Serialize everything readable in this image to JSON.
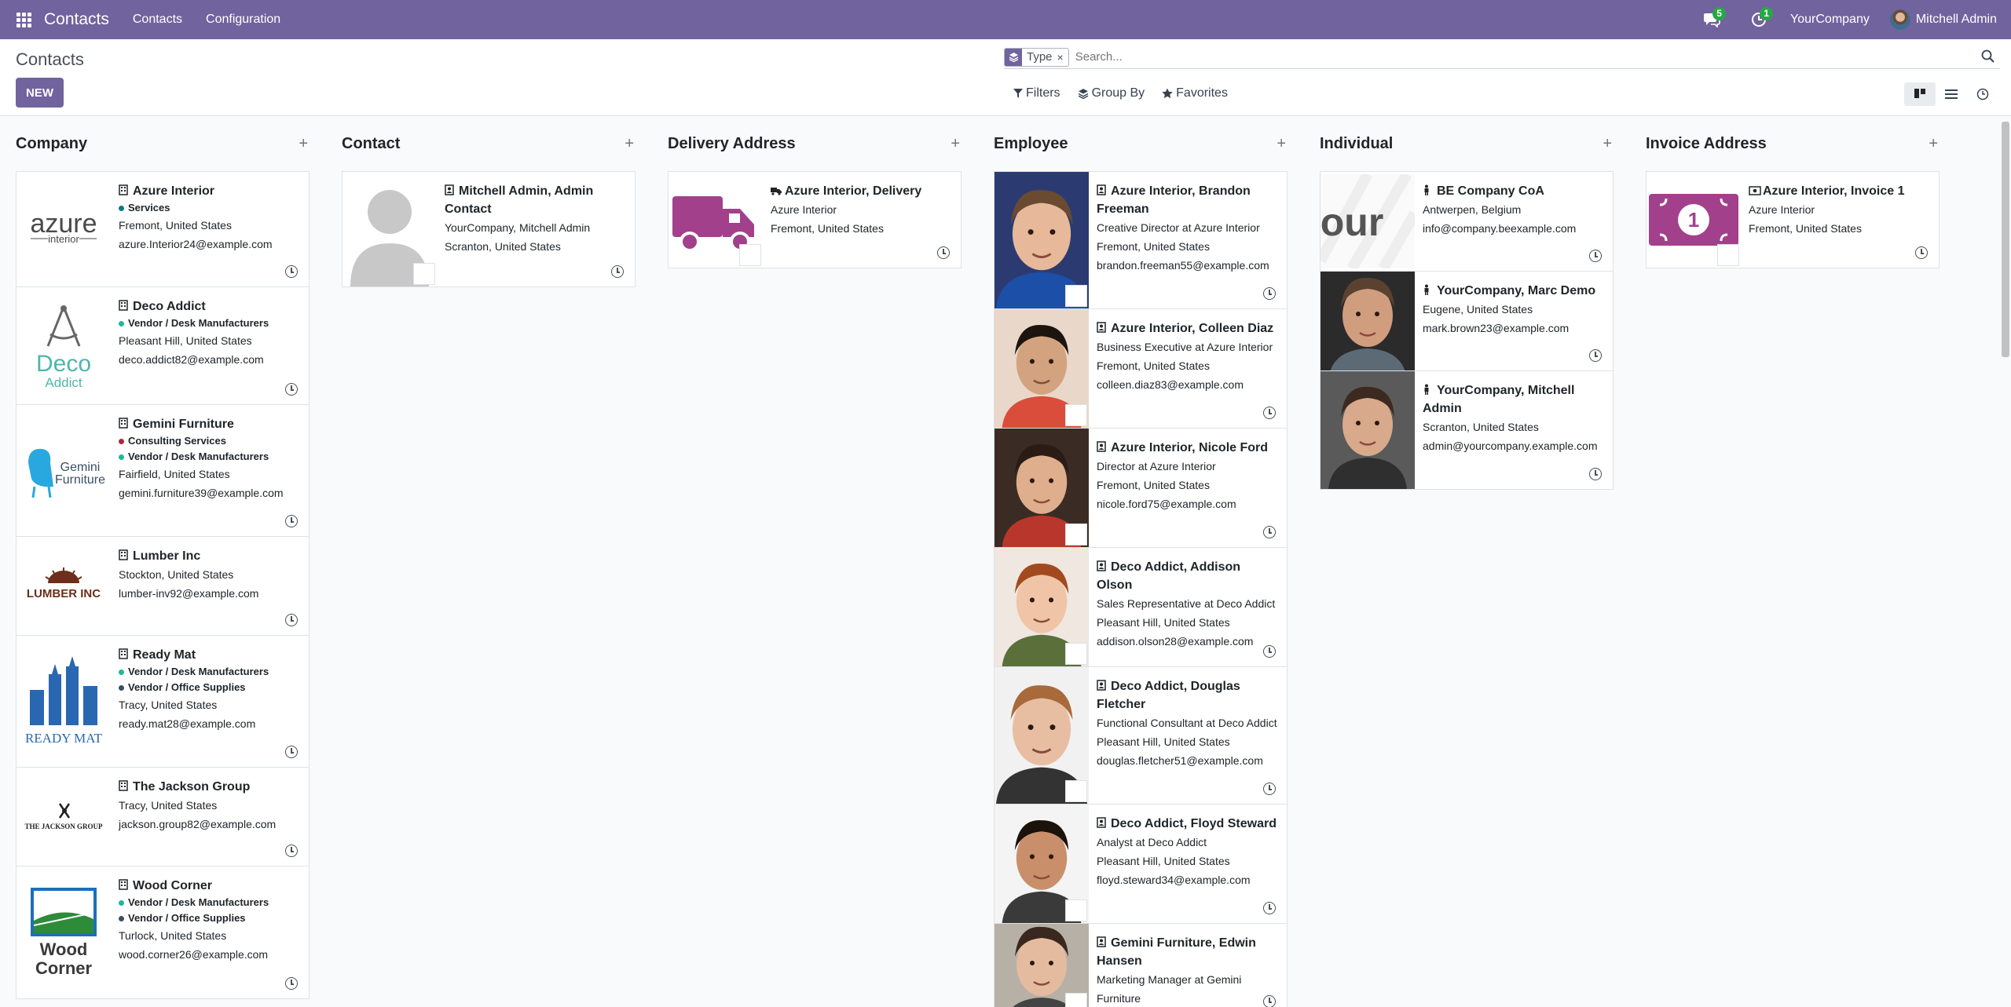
{
  "nav": {
    "app_title": "Contacts",
    "menu": [
      "Contacts",
      "Configuration"
    ],
    "messages_count": "5",
    "activities_count": "1",
    "company": "YourCompany",
    "user": "Mitchell Admin"
  },
  "control": {
    "breadcrumb": "Contacts",
    "new_label": "NEW",
    "facet_label": "Type",
    "search_placeholder": "Search...",
    "filters_label": "Filters",
    "groupby_label": "Group By",
    "favorites_label": "Favorites"
  },
  "columns": [
    {
      "title": "Company",
      "cards": [
        {
          "name": "Azure Interior",
          "tags": [
            {
              "label": "Services",
              "color": "#017e84"
            }
          ],
          "lines": [
            "Fremont, United States",
            "azure.Interior24@example.com"
          ],
          "logo": "azure"
        },
        {
          "name": "Deco Addict",
          "tags": [
            {
              "label": "Vendor / Desk Manufacturers",
              "color": "#21b799"
            }
          ],
          "lines": [
            "Pleasant Hill, United States",
            "deco.addict82@example.com"
          ],
          "logo": "deco"
        },
        {
          "name": "Gemini Furniture",
          "tags": [
            {
              "label": "Consulting Services",
              "color": "#a62a3f"
            },
            {
              "label": "Vendor / Desk Manufacturers",
              "color": "#21b799"
            }
          ],
          "lines": [
            "Fairfield, United States",
            "gemini.furniture39@example.com"
          ],
          "logo": "gemini"
        },
        {
          "name": "Lumber Inc",
          "tags": [],
          "lines": [
            "Stockton, United States",
            "lumber-inv92@example.com"
          ],
          "logo": "lumber"
        },
        {
          "name": "Ready Mat",
          "tags": [
            {
              "label": "Vendor / Desk Manufacturers",
              "color": "#21b799"
            },
            {
              "label": "Vendor / Office Supplies",
              "color": "#3b4e66"
            }
          ],
          "lines": [
            "Tracy, United States",
            "ready.mat28@example.com"
          ],
          "logo": "ready"
        },
        {
          "name": "The Jackson Group",
          "tags": [],
          "lines": [
            "Tracy, United States",
            "jackson.group82@example.com"
          ],
          "logo": "jackson"
        },
        {
          "name": "Wood Corner",
          "tags": [
            {
              "label": "Vendor / Desk Manufacturers",
              "color": "#21b799"
            },
            {
              "label": "Vendor / Office Supplies",
              "color": "#3b4e66"
            }
          ],
          "lines": [
            "Turlock, United States",
            "wood.corner26@example.com"
          ],
          "logo": "wood"
        }
      ]
    },
    {
      "title": "Contact",
      "cards": [
        {
          "name": "Mitchell Admin, Admin Contact",
          "tags": [],
          "lines": [
            "YourCompany, Mitchell Admin",
            "Scranton, United States"
          ],
          "logo": "person"
        }
      ]
    },
    {
      "title": "Delivery Address",
      "cards": [
        {
          "name": "Azure Interior, Delivery",
          "tags": [],
          "lines": [
            "Azure Interior",
            "Fremont, United States"
          ],
          "logo": "truck"
        }
      ]
    },
    {
      "title": "Employee",
      "cards": [
        {
          "name": "Azure Interior, Brandon Freeman",
          "tags": [],
          "lines": [
            "Creative Director at Azure Interior",
            "Fremont, United States",
            "brandon.freeman55@example.com"
          ],
          "logo": "face1"
        },
        {
          "name": "Azure Interior, Colleen Diaz",
          "tags": [],
          "lines": [
            "Business Executive at Azure Interior",
            "Fremont, United States",
            "colleen.diaz83@example.com"
          ],
          "logo": "face2"
        },
        {
          "name": "Azure Interior, Nicole Ford",
          "tags": [],
          "lines": [
            "Director at Azure Interior",
            "Fremont, United States",
            "nicole.ford75@example.com"
          ],
          "logo": "face3"
        },
        {
          "name": "Deco Addict, Addison Olson",
          "tags": [],
          "lines": [
            "Sales Representative at Deco Addict",
            "Pleasant Hill, United States",
            "addison.olson28@example.com"
          ],
          "logo": "face4"
        },
        {
          "name": "Deco Addict, Douglas Fletcher",
          "tags": [],
          "lines": [
            "Functional Consultant at Deco Addict",
            "Pleasant Hill, United States",
            "douglas.fletcher51@example.com"
          ],
          "logo": "face5"
        },
        {
          "name": "Deco Addict, Floyd Steward",
          "tags": [],
          "lines": [
            "Analyst at Deco Addict",
            "Pleasant Hill, United States",
            "floyd.steward34@example.com"
          ],
          "logo": "face6"
        },
        {
          "name": "Gemini Furniture, Edwin Hansen",
          "tags": [],
          "lines": [
            "Marketing Manager at Gemini Furniture"
          ],
          "logo": "face7"
        }
      ]
    },
    {
      "title": "Individual",
      "cards": [
        {
          "name": "BE Company CoA",
          "tags": [],
          "lines": [
            "Antwerpen, Belgium",
            "info@company.beexample.com"
          ],
          "logo": "our"
        },
        {
          "name": "YourCompany, Marc Demo",
          "tags": [],
          "lines": [
            "Eugene, United States",
            "mark.brown23@example.com"
          ],
          "logo": "face8"
        },
        {
          "name": "YourCompany, Mitchell Admin",
          "tags": [],
          "lines": [
            "Scranton, United States",
            "admin@yourcompany.example.com"
          ],
          "logo": "face9"
        }
      ]
    },
    {
      "title": "Invoice Address",
      "cards": [
        {
          "name": "Azure Interior, Invoice 1",
          "tags": [],
          "lines": [
            "Azure Interior",
            "Fremont, United States"
          ],
          "logo": "money"
        }
      ]
    }
  ],
  "colors": {
    "brand": "#71639e",
    "badge": "#28a745"
  }
}
